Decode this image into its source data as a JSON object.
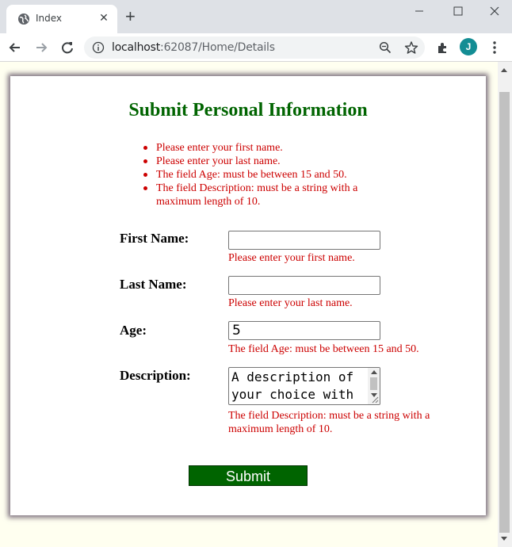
{
  "browser": {
    "tab_title": "Index",
    "url_host": "localhost",
    "url_path": ":62087/Home/Details",
    "profile_initial": "J"
  },
  "page": {
    "heading": "Submit Personal Information",
    "heading_color": "#006400",
    "error_color": "#cc0000",
    "background_color": "#fffff0",
    "summary_errors": [
      "Please enter your first name.",
      "Please enter your last name.",
      "The field Age: must be between 15 and 50.",
      "The field Description: must be a string with a maximum length of 10."
    ],
    "fields": {
      "first_name": {
        "label": "First Name:",
        "value": "",
        "error": "Please enter your first name."
      },
      "last_name": {
        "label": "Last Name:",
        "value": "",
        "error": "Please enter your last name."
      },
      "age": {
        "label": "Age:",
        "value": "5",
        "error": "The field Age: must be between 15 and 50."
      },
      "description": {
        "label": "Description:",
        "value": "A description of your choice with",
        "error": "The field Description: must be a string with a maximum length of 10."
      }
    },
    "submit_label": "Submit"
  }
}
